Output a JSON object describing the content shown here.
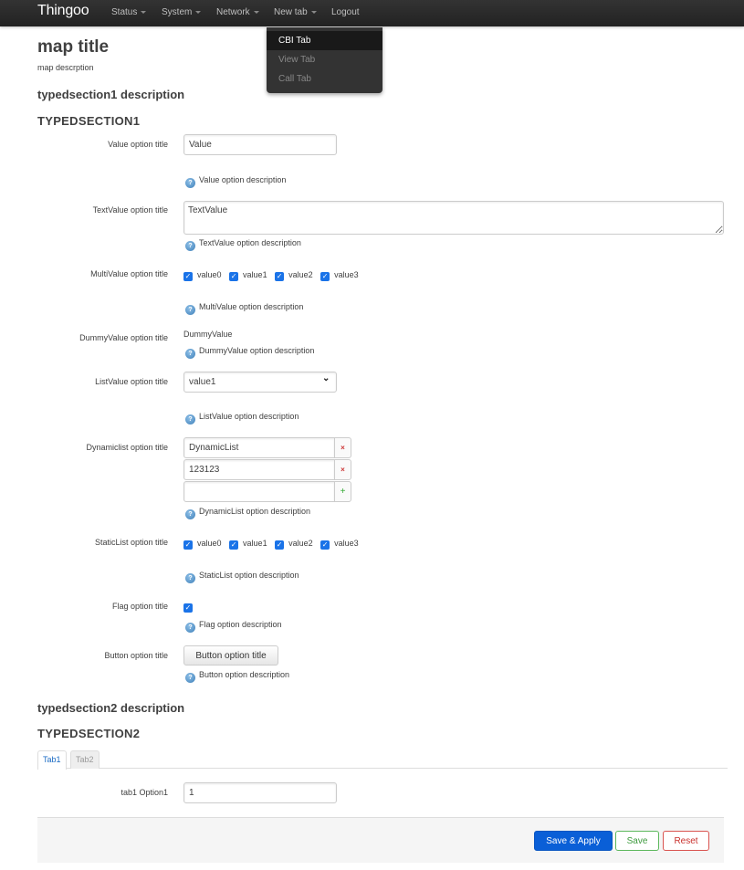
{
  "navbar": {
    "brand": "Thingoo",
    "items": [
      {
        "label": "Status",
        "has_dropdown": true
      },
      {
        "label": "System",
        "has_dropdown": true
      },
      {
        "label": "Network",
        "has_dropdown": true
      },
      {
        "label": "New tab",
        "has_dropdown": true
      },
      {
        "label": "Logout",
        "has_dropdown": false
      }
    ],
    "dropdown": {
      "parent": "New tab",
      "items": [
        {
          "label": "CBI Tab",
          "active": true
        },
        {
          "label": "View Tab",
          "active": false
        },
        {
          "label": "Call Tab",
          "active": false
        }
      ]
    }
  },
  "map": {
    "title": "map title",
    "description": "map descrption"
  },
  "section1": {
    "description": "typedsection1 description",
    "title": "TYPEDSECTION1",
    "options": {
      "value": {
        "label": "Value option title",
        "value": "Value",
        "description": "Value option description"
      },
      "textvalue": {
        "label": "TextValue option title",
        "value": "TextValue",
        "description": "TextValue option description"
      },
      "multivalue": {
        "label": "MultiValue option title",
        "choices": [
          {
            "label": "value0",
            "checked": true
          },
          {
            "label": "value1",
            "checked": true
          },
          {
            "label": "value2",
            "checked": true
          },
          {
            "label": "value3",
            "checked": true
          }
        ],
        "description": "MultiValue option description"
      },
      "dummyvalue": {
        "label": "DummyValue option title",
        "value": "DummyValue",
        "description": "DummyValue option description"
      },
      "listvalue": {
        "label": "ListValue option title",
        "selected": "value1",
        "description": "ListValue option description"
      },
      "dynamiclist": {
        "label": "Dynamiclist option title",
        "items": [
          "DynamicList",
          "123123",
          ""
        ],
        "remove_glyph": "×",
        "add_glyph": "+",
        "description": "DynamicList option description"
      },
      "staticlist": {
        "label": "StaticList option title",
        "choices": [
          {
            "label": "value0",
            "checked": true
          },
          {
            "label": "value1",
            "checked": true
          },
          {
            "label": "value2",
            "checked": true
          },
          {
            "label": "value3",
            "checked": true
          }
        ],
        "description": "StaticList option description"
      },
      "flag": {
        "label": "Flag option title",
        "checked": true,
        "description": "Flag option description"
      },
      "button": {
        "label": "Button option title",
        "button_label": "Button option title",
        "description": "Button option description"
      }
    }
  },
  "section2": {
    "description": "typedsection2 description",
    "title": "TYPEDSECTION2",
    "tabs": [
      {
        "label": "Tab1",
        "active": true
      },
      {
        "label": "Tab2",
        "active": false
      }
    ],
    "tab1_option1": {
      "label": "tab1 Option1",
      "value": "1"
    }
  },
  "actions": {
    "save_apply": "Save & Apply",
    "save": "Save",
    "reset": "Reset"
  },
  "icons": {
    "help": "?",
    "check": "✓",
    "chevron": "⌄"
  },
  "colors": {
    "navbar": "#222222",
    "primary": "#0a5fd7",
    "save": "#5cb85c",
    "reset": "#d9534f",
    "active_tab": "#1a6bc4"
  }
}
